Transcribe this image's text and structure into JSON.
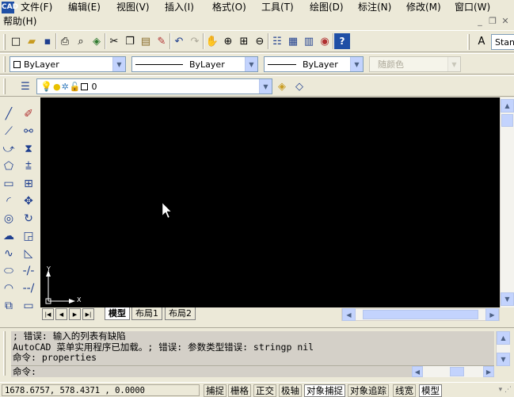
{
  "app": {
    "icon_text": "CAD"
  },
  "menu": {
    "items": [
      "文件(F)",
      "编辑(E)",
      "视图(V)",
      "插入(I)",
      "格式(O)",
      "工具(T)",
      "绘图(D)",
      "标注(N)",
      "修改(M)",
      "窗口(W)"
    ],
    "help": "帮助(H)"
  },
  "window_controls": {
    "minimize": "_",
    "restore": "❐",
    "close": "✕"
  },
  "standard_toolbar": {
    "icons": [
      "new-icon",
      "open-icon",
      "save-icon",
      "print-icon",
      "print-preview-icon",
      "publish-icon",
      "cut-icon",
      "copy-icon",
      "paste-icon",
      "match-properties-icon",
      "undo-icon",
      "redo-icon",
      "pan-icon",
      "zoom-realtime-icon",
      "zoom-window-icon",
      "zoom-previous-icon",
      "properties-icon",
      "design-center-icon",
      "tool-palettes-icon",
      "dbconnect-icon",
      "help-icon"
    ],
    "text_style_value": "Stan"
  },
  "properties_toolbar": {
    "color": "ByLayer",
    "linetype": "ByLayer",
    "lineweight": "ByLayer",
    "plot_style": "随颜色"
  },
  "layers_toolbar": {
    "current_layer": "0"
  },
  "tabs": {
    "nav": [
      "|◀",
      "◀",
      "▶",
      "▶|"
    ],
    "items": [
      {
        "label": "模型",
        "active": true
      },
      {
        "label": "布局1",
        "active": false
      },
      {
        "label": "布局2",
        "active": false
      }
    ]
  },
  "ucs": {
    "x_label": "X",
    "y_label": "Y"
  },
  "command": {
    "history": [
      "; 错误: 输入的列表有缺陷",
      "AutoCAD 菜单实用程序已加载。; 错误: 参数类型错误: stringp nil",
      "命令: properties"
    ],
    "prompt": "命令:"
  },
  "status": {
    "coordinates": "1678.6757, 578.4371 , 0.0000",
    "buttons": [
      {
        "label": "捕捉",
        "on": false
      },
      {
        "label": "栅格",
        "on": false
      },
      {
        "label": "正交",
        "on": false
      },
      {
        "label": "极轴",
        "on": false
      },
      {
        "label": "对象捕捉",
        "on": true
      },
      {
        "label": "对象追踪",
        "on": false
      },
      {
        "label": "线宽",
        "on": false
      },
      {
        "label": "模型",
        "on": true
      }
    ]
  },
  "colors": {
    "canvas": "#000000",
    "chrome": "#ece9d8",
    "accent": "#1f4fa5"
  }
}
